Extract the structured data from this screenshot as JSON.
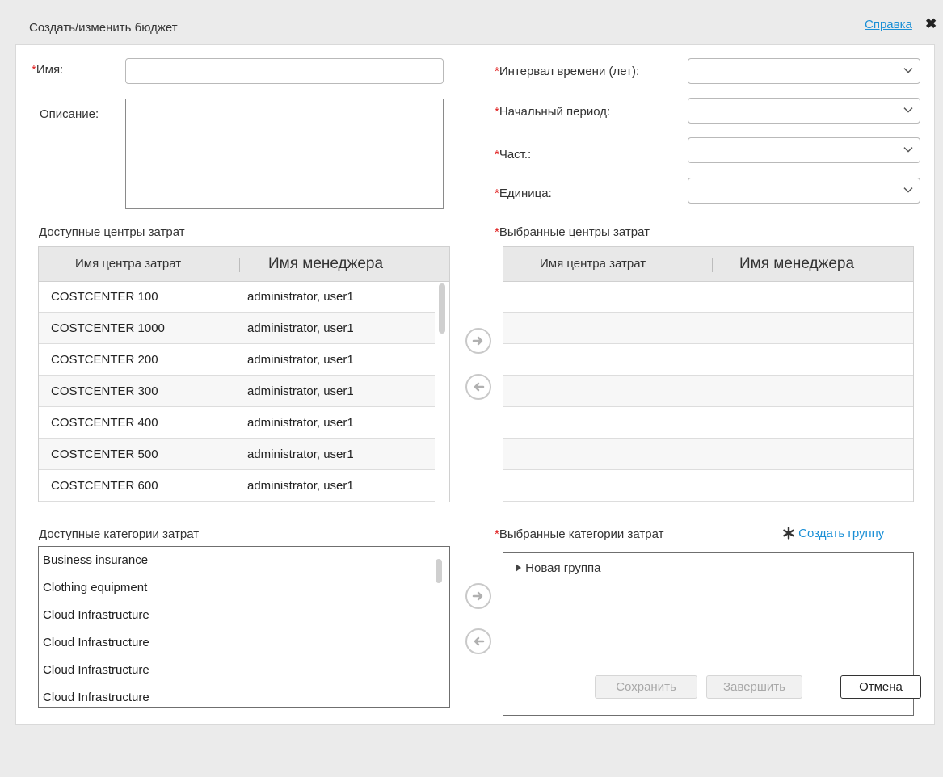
{
  "dialog": {
    "title": "Создать/изменить бюджет",
    "help_link": "Справка",
    "close_symbol": "✖"
  },
  "form": {
    "required_mark": "*",
    "name_label": "Имя:",
    "name_value": "",
    "description_label": "Описание:",
    "description_value": "",
    "time_interval_label": "Интервал времени (лет):",
    "time_interval_value": "",
    "start_period_label": "Начальный период:",
    "start_period_value": "",
    "frequency_label": "Част.:",
    "frequency_value": "",
    "unit_label": "Единица:",
    "unit_value": ""
  },
  "available_cost_centers": {
    "title": "Доступные центры затрат",
    "columns": [
      "Имя центра затрат",
      "Имя менеджера"
    ],
    "rows": [
      {
        "name": "COSTCENTER 100",
        "manager": "administrator, user1"
      },
      {
        "name": "COSTCENTER 1000",
        "manager": "administrator, user1"
      },
      {
        "name": "COSTCENTER 200",
        "manager": "administrator, user1"
      },
      {
        "name": "COSTCENTER 300",
        "manager": "administrator, user1"
      },
      {
        "name": "COSTCENTER 400",
        "manager": "administrator, user1"
      },
      {
        "name": "COSTCENTER 500",
        "manager": "administrator, user1"
      },
      {
        "name": "COSTCENTER 600",
        "manager": "administrator, user1"
      }
    ]
  },
  "selected_cost_centers": {
    "title": "Выбранные центры затрат",
    "columns": [
      "Имя центра затрат",
      "Имя менеджера"
    ],
    "rows": []
  },
  "available_categories": {
    "title": "Доступные категории затрат",
    "items": [
      "Business insurance",
      "Clothing equipment",
      "Cloud Infrastructure",
      "Cloud Infrastructure",
      "Cloud Infrastructure",
      "Cloud Infrastructure"
    ]
  },
  "selected_categories": {
    "title": "Выбранные категории затрат",
    "create_group": "Создать группу",
    "items": [
      "Новая группа"
    ]
  },
  "buttons": {
    "save": "Сохранить",
    "finish": "Завершить",
    "cancel": "Отмена"
  },
  "colors": {
    "link": "#1a8fd6",
    "required": "#e02020",
    "header_bg": "#e8e8e8"
  },
  "icons": {
    "move_right": "arrow-right-circle-icon",
    "move_left": "arrow-left-circle-icon",
    "dropdown": "chevron-down-icon",
    "create_group": "asterisk-icon",
    "tree_expand": "triangle-right-icon",
    "close": "close-icon"
  }
}
